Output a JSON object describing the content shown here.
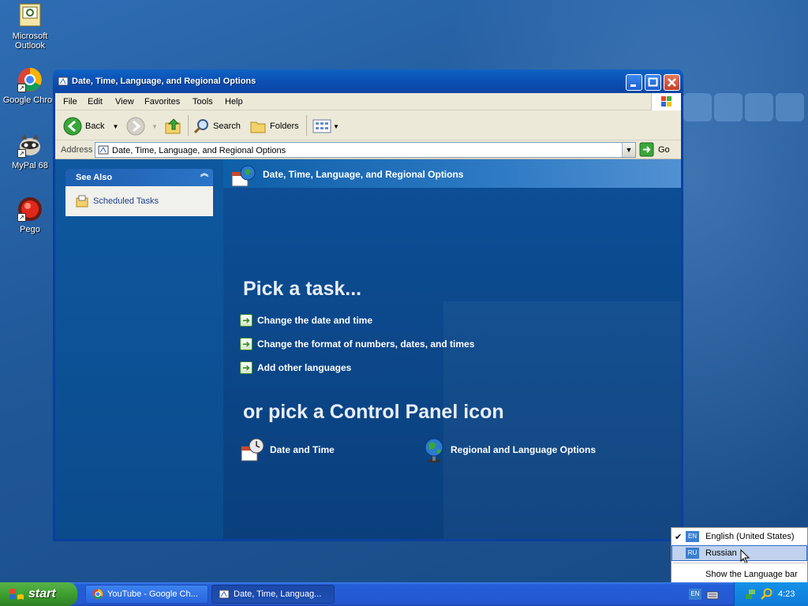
{
  "desktop": {
    "icons": [
      {
        "label": "Microsoft\nOutlook",
        "icon": "outlook-icon"
      },
      {
        "label": "Google Chron",
        "icon": "chrome-icon"
      },
      {
        "label": "MyPal 68",
        "icon": "mypal-icon"
      },
      {
        "label": "Pego",
        "icon": "pego-icon"
      }
    ]
  },
  "window": {
    "title": "Date, Time, Language, and Regional Options",
    "menu": [
      "File",
      "Edit",
      "View",
      "Favorites",
      "Tools",
      "Help"
    ],
    "toolbar": {
      "back": "Back",
      "search": "Search",
      "folders": "Folders"
    },
    "address": {
      "label": "Address",
      "value": "Date, Time, Language, and Regional Options",
      "go": "Go"
    },
    "see_also": {
      "title": "See Also",
      "items": [
        "Scheduled Tasks"
      ]
    },
    "category_title": "Date, Time, Language, and Regional Options",
    "pick_task": "Pick a task...",
    "tasks": [
      "Change the date and time",
      "Change the format of numbers, dates, and times",
      "Add other languages"
    ],
    "pick_icon": "or pick a Control Panel icon",
    "cp_icons": [
      "Date and Time",
      "Regional and Language Options"
    ]
  },
  "language_menu": {
    "items": [
      {
        "code": "EN",
        "label": "English (United States)",
        "checked": true
      },
      {
        "code": "RU",
        "label": "Russian",
        "checked": false,
        "highlighted": true
      }
    ],
    "show_bar": "Show the Language bar"
  },
  "taskbar": {
    "start": "start",
    "buttons": [
      "YouTube - Google Ch...",
      "Date, Time, Languag..."
    ],
    "lang_indicator": "EN",
    "clock": "4:23"
  },
  "colors": {
    "xp_blue": "#235ed8",
    "start_green": "#3b9a2c",
    "content_blue": "#0d4f97"
  }
}
